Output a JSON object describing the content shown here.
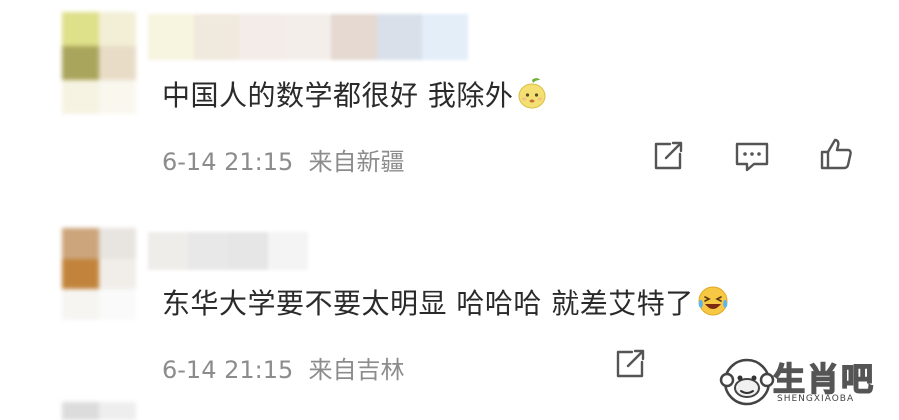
{
  "comments": [
    {
      "text": "中国人的数学都很好 我除外",
      "emoji": "pear-face-emoji",
      "timestamp": "6-14 21:15",
      "location": "来自新疆"
    },
    {
      "text": "东华大学要不要太明显 哈哈哈 就差艾特了",
      "emoji": "laughing-crying-emoji",
      "timestamp": "6-14 21:15",
      "location": "来自吉林"
    }
  ],
  "actions": {
    "share": "share-icon",
    "comment": "comment-icon",
    "like": "like-icon"
  },
  "watermark": {
    "logo_text": "生肖吧",
    "sub_text": "SHENGXIAOBA"
  },
  "colors": {
    "text": "#2a2a2a",
    "meta": "#8c8c8c",
    "icon": "#555555"
  }
}
